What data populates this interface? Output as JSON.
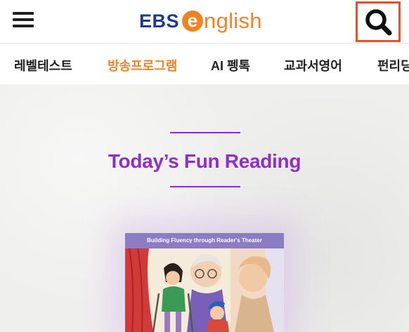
{
  "header": {
    "logo_text_ebs": "EBS",
    "logo_text_e": "e",
    "logo_text_rest": "nglish"
  },
  "nav": {
    "items": [
      {
        "label": "레벨테스트",
        "active": false
      },
      {
        "label": "방송프로그램",
        "active": true
      },
      {
        "label": "AI 펭톡",
        "active": false
      },
      {
        "label": "교과서영어",
        "active": false
      },
      {
        "label": "펀리딩",
        "active": false
      }
    ]
  },
  "main": {
    "heading": "Today’s Fun Reading",
    "book_banner": "Building Fluency through Reader's Theater"
  },
  "colors": {
    "accent_orange": "#f58220",
    "heading_purple": "#8e2fc6",
    "logo_navy": "#1f3a8a",
    "search_outline": "#e8522a"
  },
  "icons": {
    "menu": "hamburger-menu-icon",
    "search": "search-icon"
  }
}
